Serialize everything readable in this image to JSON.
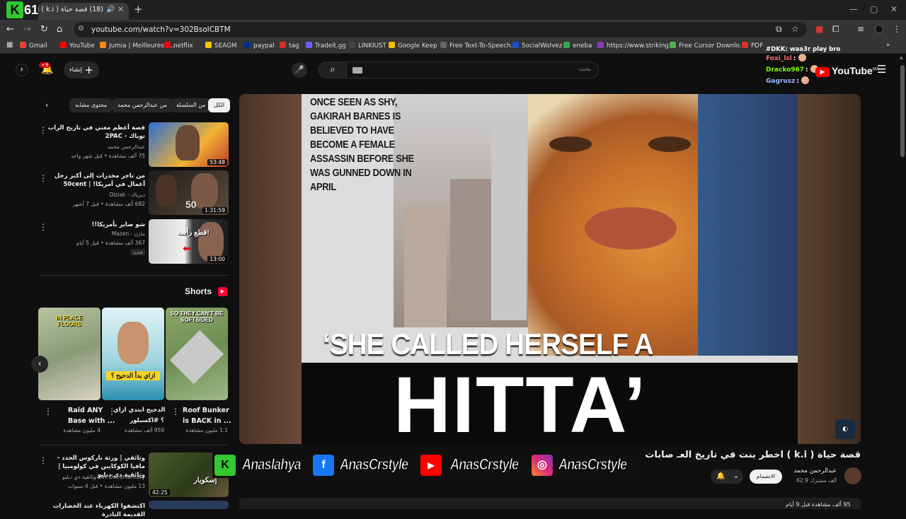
{
  "browser": {
    "badge_letter": "K",
    "badge_number": "61",
    "tab_title": "(18) قصة حياة ( k.i ) اخط...",
    "url": "youtube.com/watch?v=302BsolCBTM",
    "new_tab": "+",
    "close_tab": "×",
    "bookmarks": [
      {
        "label": "Gmail",
        "color": "#ea4335"
      },
      {
        "label": "YouTube",
        "color": "#ff0000"
      },
      {
        "label": "Jumia | Meilleures o...",
        "color": "#f68b1e"
      },
      {
        "label": "netflix",
        "color": "#e50914"
      },
      {
        "label": "SEAGM",
        "color": "#f5c400"
      },
      {
        "label": "paypal",
        "color": "#003087"
      },
      {
        "label": "tag",
        "color": "#d93025"
      },
      {
        "label": "Tradeit.gg",
        "color": "#6b5bff"
      },
      {
        "label": "LINKIUST",
        "color": "#444444"
      },
      {
        "label": "Google Keep",
        "color": "#fbbc04"
      },
      {
        "label": "Free Text-To-Speech...",
        "color": "#666666"
      },
      {
        "label": "SocialWolvez",
        "color": "#1a4fd0"
      },
      {
        "label": "eneba",
        "color": "#34a853"
      },
      {
        "label": "https://www.striking...",
        "color": "#8a3ab9"
      },
      {
        "label": "Free Cursor Downlo...",
        "color": "#4caf50"
      },
      {
        "label": "PDF",
        "color": "#d93025"
      }
    ]
  },
  "yt": {
    "create_label": "إنشاء",
    "notif_count": "+9",
    "search_placeholder": "بحث",
    "logo": "YouTube",
    "logo_region": "MA",
    "avatar_letter": "F"
  },
  "chat": [
    {
      "user": "Foxi_lsl",
      "text": ":",
      "color": "#ff6b6b"
    },
    {
      "user": "Dracko967",
      "text": ":",
      "color": "#7CFC00"
    },
    {
      "user": "Gagrusz",
      "text": ":",
      "color": "#9ab8ff"
    }
  ],
  "chat_overlay": "#DKK: waa3r play bro",
  "chips": [
    "الكل",
    "من السلسلة",
    "من عبدالرحمن محمد",
    "محتوى مشابه"
  ],
  "recommendations": [
    {
      "title": "قصة أعظم مغني في تاريخ الراب توباك - 2PAC",
      "channel": "عبدالرحمن محمد",
      "meta": "75 ألف مشاهدة • قبل شهر واحد",
      "duration": "53:48"
    },
    {
      "title": "من تاجر مخدرات إلى أكبر رجل أعمال في أمريكا! | 50cent",
      "channel": "ديزياك - Diziak",
      "meta": "682 ألف مشاهدة • قبل 7 أشهر",
      "duration": "1:31:59"
    },
    {
      "title": "شو صاير بأمريكا!!",
      "channel": "مازن - Mazen",
      "meta": "367 ألف مشاهدة • قبل 5 أيام",
      "badge": "جديد",
      "duration": "13:00"
    }
  ],
  "shorts": {
    "title": "Shorts",
    "items": [
      {
        "caption": "IN PLACE FLOORS",
        "title1": "Raid ANY",
        "title2": "Base with ...",
        "views": "4 مليون مشاهدة"
      },
      {
        "caption": "ازاي بدأ الدحيح ؟",
        "title1": "الدحيح ابتدي ازاي",
        "title2": "؟ #اكسبلور",
        "views": "959 ألف مشاهدة"
      },
      {
        "caption": "SO THEY CAN'T BE SOFTSIDED",
        "title1": "Roof Bunker",
        "title2": "is BACK in ...",
        "views": "1.1 مليون مشاهدة"
      }
    ]
  },
  "rec4": {
    "title": "وثائقي | ورثة ناركوس الجدد - مافيا الكوكايين في كولومبيا | وثائقية دي دبليو",
    "channel": "DW Documentary وثائقية دي دبليو",
    "meta": "13 مليون مشاهدة • قبل 4 سنوات",
    "duration": "42:25"
  },
  "rec5": {
    "title": "اكتشفوا الكهرباء عند الحضارات القديمة النادرة"
  },
  "video": {
    "caption": "ONCE SEEN AS SHY, GAKIRAH BARNES IS BELIEVED TO HAVE BECOME A FEMALE ASSASSIN BEFORE SHE WAS GUNNED DOWN IN APRIL",
    "quote1": "‘SHE CALLED HERSELF A",
    "quote2": "HITTA’",
    "title": "قصة حياة ( k.i ) اخطر بنت في تاريخ العـ صابات",
    "channel": "عبدالرحمن محمد",
    "subs": "62.9 ألف مشترك",
    "join": "الانضمام",
    "bottom": "95 ألف مشاهدة قبل 9 أيام"
  },
  "social": [
    {
      "icon": "K",
      "handle": "Anaslahya",
      "color": "#32c832"
    },
    {
      "icon": "f",
      "handle": "AnasCrstyle",
      "color": "#1877f2"
    },
    {
      "icon": "▶",
      "handle": "AnasCrstyle",
      "color": "#ff0000"
    },
    {
      "icon": "◎",
      "handle": "AnasCrstyle",
      "color": "#d6249f"
    }
  ]
}
